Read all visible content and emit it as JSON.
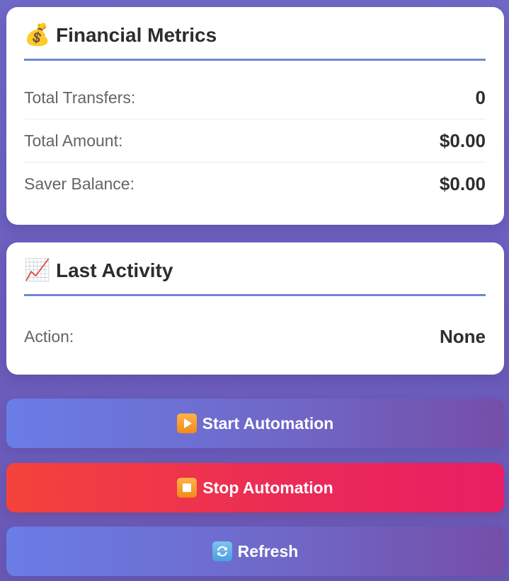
{
  "metrics_card": {
    "icon": "money-bag-icon",
    "icon_glyph": "💰",
    "title": "Financial Metrics",
    "rows": [
      {
        "label": "Total Transfers:",
        "value": "0"
      },
      {
        "label": "Total Amount:",
        "value": "$0.00"
      },
      {
        "label": "Saver Balance:",
        "value": "$0.00"
      }
    ]
  },
  "activity_card": {
    "icon": "chart-increasing-icon",
    "icon_glyph": "📈",
    "title": "Last Activity",
    "rows": [
      {
        "label": "Action:",
        "value": "None"
      }
    ]
  },
  "buttons": {
    "start": {
      "label": "Start Automation",
      "icon": "play-icon"
    },
    "stop": {
      "label": "Stop Automation",
      "icon": "stop-icon"
    },
    "refresh": {
      "label": "Refresh",
      "icon": "refresh-icon"
    }
  },
  "colors": {
    "accent": "#7286d3",
    "stop_gradient_start": "#f4433b",
    "stop_gradient_end": "#e91e63",
    "primary_gradient_start": "#6a7de6",
    "primary_gradient_end": "#754ea8"
  }
}
